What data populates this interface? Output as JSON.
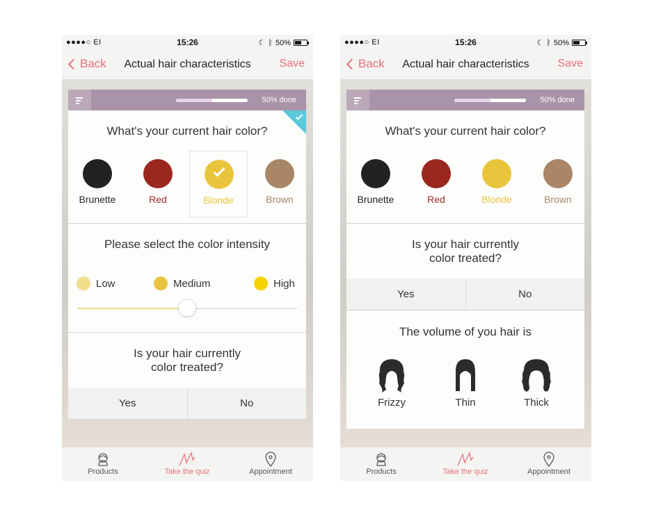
{
  "colors": {
    "accent": "#e8707a",
    "progress_bar": "#a993a8",
    "selected_corner": "#5cc8dc",
    "brunette": "#222222",
    "red": "#9b2820",
    "blonde": "#e9c43d",
    "brown": "#a88667",
    "low": "#f2df8e",
    "medium": "#eac441",
    "high": "#f6d200"
  },
  "status_bar": {
    "carrier": "●●●●○ EI",
    "time": "15:26",
    "battery": "50%"
  },
  "nav": {
    "back_label": "Back",
    "title": "Actual hair characteristics",
    "save_label": "Save"
  },
  "progress": {
    "label": "50% done",
    "value": 0.5
  },
  "hair_color": {
    "question": "What's your current hair color?",
    "options": [
      {
        "label": "Brunette",
        "color": "#222222"
      },
      {
        "label": "Red",
        "color": "#9b2820"
      },
      {
        "label": "Blonde",
        "color": "#e9c43d"
      },
      {
        "label": "Brown",
        "color": "#a88667"
      }
    ],
    "selected_left": "Blonde"
  },
  "intensity": {
    "question": "Please select the color intensity",
    "options": [
      "Low",
      "Medium",
      "High"
    ],
    "slider_value": 0.5
  },
  "treated": {
    "question_line1": "Is your hair currently",
    "question_line2": "color treated?",
    "yes": "Yes",
    "no": "No"
  },
  "volume": {
    "question": "The volume of you hair is",
    "options": [
      {
        "label": "Frizzy",
        "icon": "frizzy-hair-icon"
      },
      {
        "label": "Thin",
        "icon": "thin-hair-icon"
      },
      {
        "label": "Thick",
        "icon": "thick-hair-icon"
      }
    ]
  },
  "tabs": [
    {
      "label": "Products",
      "icon": "products-icon",
      "active": false
    },
    {
      "label": "Take the quiz",
      "icon": "quiz-icon",
      "active": true
    },
    {
      "label": "Appointment",
      "icon": "location-pin-icon",
      "active": false
    }
  ]
}
